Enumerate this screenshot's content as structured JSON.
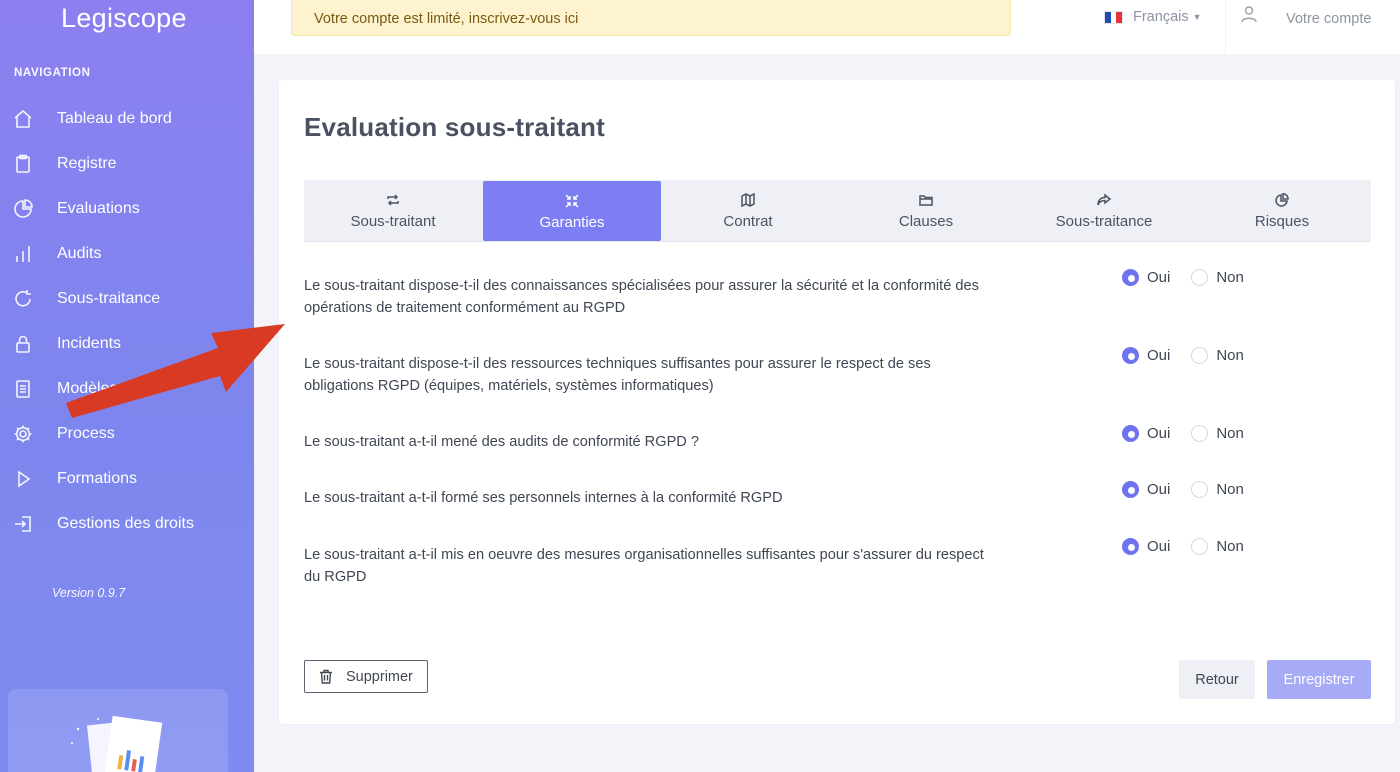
{
  "app": {
    "brand": "Legiscope",
    "version": "Version 0.9.7"
  },
  "sidebar": {
    "title": "NAVIGATION",
    "items": [
      {
        "label": "Tableau de bord",
        "icon": "home-icon"
      },
      {
        "label": "Registre",
        "icon": "clipboard-icon"
      },
      {
        "label": "Evaluations",
        "icon": "pie-chart-icon"
      },
      {
        "label": "Audits",
        "icon": "bar-chart-icon"
      },
      {
        "label": "Sous-traitance",
        "icon": "refresh-icon"
      },
      {
        "label": "Incidents",
        "icon": "lock-icon"
      },
      {
        "label": "Modèles types",
        "icon": "document-icon"
      },
      {
        "label": "Process",
        "icon": "gear-icon"
      },
      {
        "label": "Formations",
        "icon": "play-icon"
      },
      {
        "label": "Gestions des droits",
        "icon": "login-icon"
      }
    ]
  },
  "topbar": {
    "alert": "Votre compte est limité, inscrivez-vous ici",
    "language": "Français",
    "account": "Votre compte"
  },
  "page": {
    "title": "Evaluation sous-traitant"
  },
  "tabs": [
    {
      "label": "Sous-traitant",
      "icon": "repeat-icon",
      "active": false
    },
    {
      "label": "Garanties",
      "icon": "collapse-icon",
      "active": true
    },
    {
      "label": "Contrat",
      "icon": "map-icon",
      "active": false
    },
    {
      "label": "Clauses",
      "icon": "folder-icon",
      "active": false
    },
    {
      "label": "Sous-traitance",
      "icon": "share-icon",
      "active": false
    },
    {
      "label": "Risques",
      "icon": "pie-chart-icon",
      "active": false
    }
  ],
  "questions": [
    {
      "line1": "Le sous-traitant dispose-t-il des connaissances spécialisées pour assurer la sécurité et la conformité des",
      "line2": "opérations de traitement conformément au RGPD",
      "answer": "Oui"
    },
    {
      "line1": "Le sous-traitant dispose-t-il des ressources techniques suffisantes pour assurer le respect de ses",
      "line2": "obligations RGPD (équipes, matériels, systèmes informatiques)",
      "answer": "Oui"
    },
    {
      "line1": "Le sous-traitant a-t-il mené des audits de conformité RGPD ?",
      "line2": "",
      "answer": "Oui"
    },
    {
      "line1": "Le sous-traitant a-t-il formé ses personnels internes à la conformité RGPD",
      "line2": "",
      "answer": "Oui"
    },
    {
      "line1": "Le sous-traitant a-t-il mis en oeuvre des mesures organisationnelles suffisantes pour s'assurer du respect",
      "line2": "du RGPD",
      "answer": "Oui"
    }
  ],
  "options": {
    "yes": "Oui",
    "no": "Non"
  },
  "actions": {
    "delete": "Supprimer",
    "back": "Retour",
    "save": "Enregistrer"
  },
  "colors": {
    "sidebar": "#8c7ff0",
    "accent": "#7d7ef3",
    "annotation_arrow": "#d83a24"
  }
}
